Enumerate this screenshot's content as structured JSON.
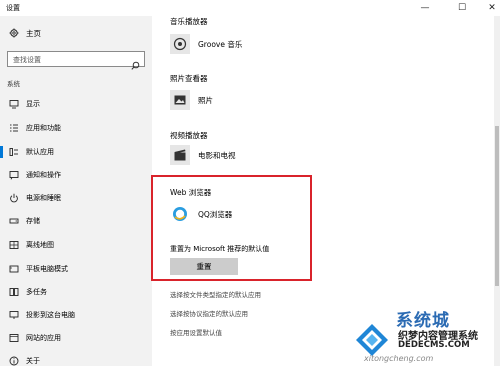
{
  "window": {
    "title": "设置",
    "min_glyph": "—",
    "max_glyph": "☐",
    "close_glyph": "✕"
  },
  "sidebar": {
    "home_label": "主页",
    "search_placeholder": "查找设置",
    "section_label": "系统",
    "items": [
      {
        "label": "显示",
        "icon": "monitor-icon"
      },
      {
        "label": "应用和功能",
        "icon": "apps-list-icon"
      },
      {
        "label": "默认应用",
        "icon": "default-apps-icon",
        "active": true
      },
      {
        "label": "通知和操作",
        "icon": "notification-icon"
      },
      {
        "label": "电源和睡眠",
        "icon": "power-icon"
      },
      {
        "label": "存储",
        "icon": "storage-icon"
      },
      {
        "label": "离线地图",
        "icon": "offline-map-icon"
      },
      {
        "label": "平板电脑模式",
        "icon": "tablet-icon"
      },
      {
        "label": "多任务",
        "icon": "multitask-icon"
      },
      {
        "label": "投影到这台电脑",
        "icon": "project-icon"
      },
      {
        "label": "网站的应用",
        "icon": "web-apps-icon"
      },
      {
        "label": "关于",
        "icon": "info-icon"
      }
    ]
  },
  "main": {
    "music": {
      "title": "音乐播放器",
      "app": "Groove 音乐"
    },
    "photo": {
      "title": "照片查看器",
      "app": "照片"
    },
    "video": {
      "title": "视频播放器",
      "app": "电影和电视"
    },
    "browser": {
      "title": "Web 浏览器",
      "app": "QQ浏览器"
    },
    "reset": {
      "label": "重置为 Microsoft 推荐的默认值",
      "button": "重置"
    },
    "links": [
      "选择按文件类型指定的默认应用",
      "选择按协议指定的默认应用",
      "按应用设置默认值"
    ]
  },
  "watermark": {
    "big": "系统城",
    "line1": "织梦内容管理系统",
    "line2": "DEDECMS.COM",
    "line3": "xitongcheng.com"
  },
  "colors": {
    "accent": "#0078d7",
    "highlight_border": "#d9232b",
    "sidebar_bg": "#f2f2f2"
  }
}
